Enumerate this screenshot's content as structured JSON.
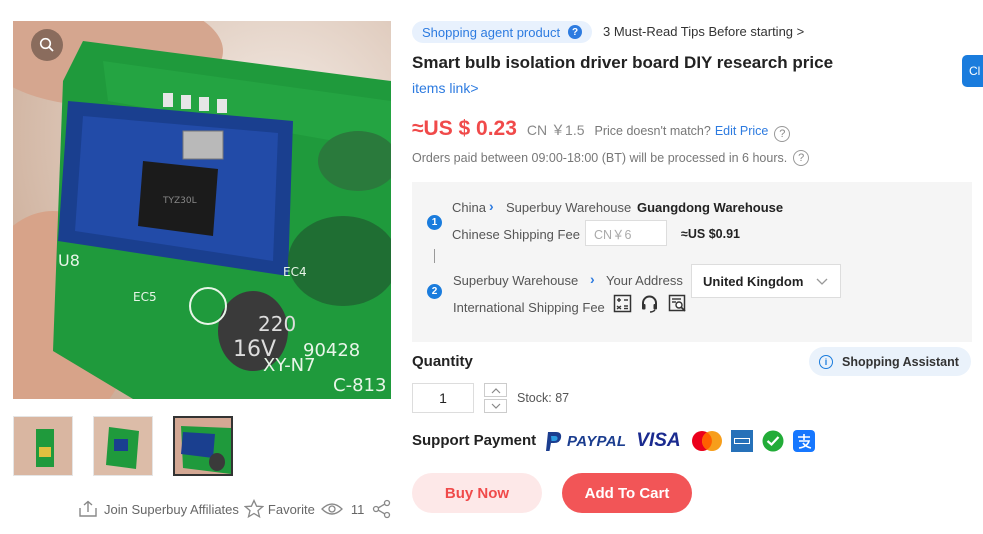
{
  "gallery": {
    "zoom_icon": "magnifier-icon",
    "main_image_markings": [
      "U8",
      "EC5",
      "EC4",
      "16V",
      "220",
      "XY-N7",
      "90428",
      "C-813"
    ],
    "thumbnails": [
      {
        "name": "thumbnail-1",
        "active": false
      },
      {
        "name": "thumbnail-2",
        "active": false
      },
      {
        "name": "thumbnail-3",
        "active": true
      }
    ]
  },
  "share": {
    "affiliates_label": "Join Superbuy Affiliates",
    "favorite_label": "Favorite",
    "views_count": "11"
  },
  "header": {
    "agent_badge": "Shopping agent product",
    "agent_badge_help": "?",
    "tips_link": "3 Must-Read Tips Before starting >"
  },
  "product": {
    "title": "Smart bulb isolation driver board DIY research price",
    "items_link": "items link>"
  },
  "price": {
    "usd": "≈US $ 0.23",
    "cny": "CN ￥1.5",
    "mismatch_text": "Price doesn't match?",
    "edit_price": "Edit Price",
    "help": "?",
    "orders_note": "Orders paid between 09:00-18:00 (BT) will be processed in 6 hours."
  },
  "shipping": {
    "step1": {
      "number": "1",
      "origin": "China",
      "via": "Superbuy Warehouse",
      "destination": "Guangdong Warehouse",
      "fee_label": "Chinese Shipping Fee",
      "fee_placeholder": "CN￥6",
      "fee_usd": "≈US $0.91"
    },
    "step2": {
      "number": "2",
      "origin": "Superbuy Warehouse",
      "destination": "Your Address",
      "country": "United Kingdom",
      "fee_label": "International Shipping Fee",
      "icons": [
        "calculator-icon",
        "headset-icon",
        "search-list-icon"
      ]
    }
  },
  "quantity": {
    "label": "Quantity",
    "value": "1",
    "stock": "Stock: 87",
    "assistant": "Shopping Assistant"
  },
  "payment": {
    "label": "Support Payment",
    "paypal": "PAYPAL",
    "visa": "VISA",
    "methods": [
      "paypal-logo",
      "visa-logo",
      "mastercard-logo",
      "amex-logo",
      "wechat-pay-logo",
      "alipay-logo"
    ]
  },
  "actions": {
    "buy_now": "Buy Now",
    "add_to_cart": "Add To Cart"
  },
  "side_tab": {
    "label": "Cl"
  },
  "colors": {
    "accent_blue": "#2d7be0",
    "price_red": "#f04a4a",
    "cart_button": "#f25557",
    "buy_button_bg": "#fde8e8",
    "pcb_green": "#1f9a3c"
  }
}
